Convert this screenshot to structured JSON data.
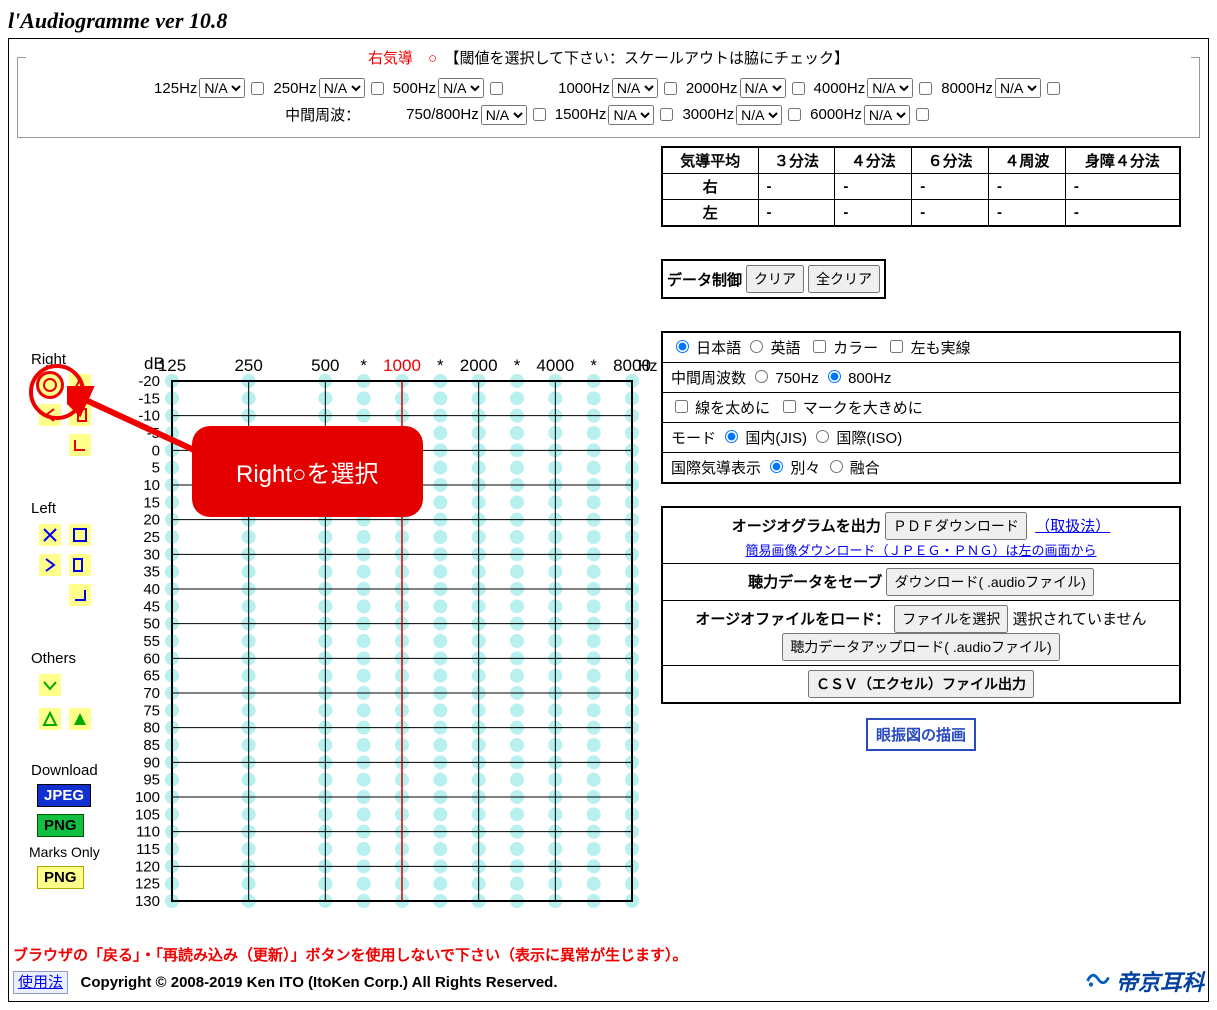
{
  "title": "l'Audiogramme ver 10.8",
  "legend": {
    "side": "右気導　○",
    "instruction": "　【閾値を選択して下さい：スケールアウトは脇にチェック】"
  },
  "freq_row1": [
    {
      "label": "125Hz",
      "value": "N/A"
    },
    {
      "label": "250Hz",
      "value": "N/A"
    },
    {
      "label": "500Hz",
      "value": "N/A"
    },
    {
      "label": "1000Hz",
      "value": "N/A"
    },
    {
      "label": "2000Hz",
      "value": "N/A"
    },
    {
      "label": "4000Hz",
      "value": "N/A"
    },
    {
      "label": "8000Hz",
      "value": "N/A"
    }
  ],
  "freq_mid_label": "中間周波：",
  "freq_row2": [
    {
      "label": "750/800Hz",
      "value": "N/A"
    },
    {
      "label": "1500Hz",
      "value": "N/A"
    },
    {
      "label": "3000Hz",
      "value": "N/A"
    },
    {
      "label": "6000Hz",
      "value": "N/A"
    }
  ],
  "avg": {
    "header": [
      "気導平均",
      "３分法",
      "４分法",
      "６分法",
      "４周波",
      "身障４分法"
    ],
    "right": "右",
    "left": "左",
    "cell": "-"
  },
  "data_ctrl": {
    "label": "データ制御",
    "clear": "クリア",
    "clear_all": "全クリア"
  },
  "opts": {
    "japanese": "日本語",
    "english": "英語",
    "color": "カラー",
    "left_solid": "左も実線",
    "midfreq": "中間周波数",
    "f750": "750Hz",
    "f800": "800Hz",
    "thick": "線を太めに",
    "bigmark": "マークを大きめに",
    "mode": "モード",
    "jis": "国内(JIS)",
    "iso": "国際(ISO)",
    "intl_disp": "国際気導表示",
    "separate": "別々",
    "merge": "融合"
  },
  "out": {
    "audio_out": "オージオグラムを出力",
    "pdf": "ＰＤＦダウンロード",
    "manual": "（取扱法）",
    "simple_dl": "簡易画像ダウンロード（ＪＰＥＧ・ＰＮＧ）は左の画面から",
    "save_audio": "聴力データをセーブ",
    "dl_audio": "ダウンロード( .audioファイル)",
    "load_audio": "オージオファイルをロード：",
    "choose": "ファイルを選択",
    "nofile": "選択されていません",
    "upload": "聴力データアップロード( .audioファイル)",
    "csv": "ＣＳＶ（エクセル）ファイル出力"
  },
  "nys": "眼振図の描画",
  "chart_data": {
    "type": "audiogram-grid",
    "x_labels": [
      "125",
      "250",
      "500",
      "*",
      "1000",
      "*",
      "2000",
      "*",
      "4000",
      "*",
      "8000"
    ],
    "x_unit": "Hz",
    "y_label": "dB",
    "y_values": [
      -20,
      -15,
      -10,
      -5,
      0,
      5,
      10,
      15,
      20,
      25,
      30,
      35,
      40,
      45,
      50,
      55,
      60,
      65,
      70,
      75,
      80,
      85,
      90,
      95,
      100,
      105,
      110,
      115,
      120,
      125,
      130
    ],
    "highlight_x": "1000",
    "marks": {
      "right_label": "Right",
      "left_label": "Left",
      "others_label": "Others",
      "download_label": "Download",
      "marks_only_label": "Marks Only",
      "jpeg": "JPEG",
      "png": "PNG"
    }
  },
  "callout": "Right○を選択",
  "footer": {
    "warn": "ブラウザの「戻る」・「再読み込み（更新）」ボタンを使用しないで下さい（表示に異常が生じます）。",
    "use": "使用法",
    "copyright": "Copyright © 2008-2019 Ken ITO (ItoKen Corp.) All Rights Reserved.",
    "logo": "帝京耳科"
  }
}
